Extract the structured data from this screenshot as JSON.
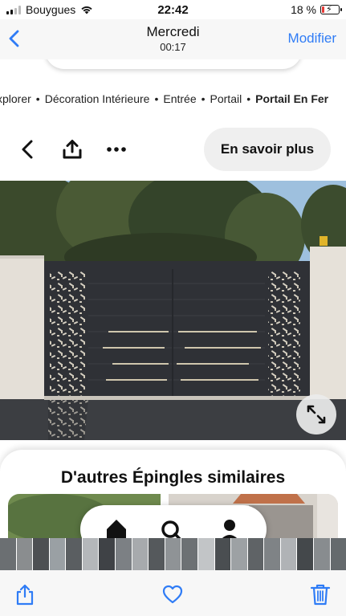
{
  "status_bar": {
    "carrier": "Bouygues",
    "time": "22:42",
    "battery_percent": "18 %",
    "battery_level": 0.18
  },
  "header": {
    "back_icon": "chevron-left-icon",
    "title": "Mercredi",
    "subtitle": "00:17",
    "edit_label": "Modifier"
  },
  "screenshot": {
    "breadcrumb": [
      "xplorer",
      "Décoration Intérieure",
      "Entrée",
      "Portail",
      "Portail En Fer"
    ],
    "breadcrumb_separator": "•",
    "toolbar": {
      "icons": [
        "chevron-left-icon",
        "share-icon",
        "more-icon"
      ],
      "learn_more_label": "En savoir plus"
    },
    "similar_title": "D'autres Épingles similaires",
    "bottom_nav_icons": [
      "home-icon",
      "search-icon",
      "profile-icon"
    ]
  },
  "bottom_toolbar": {
    "icons": [
      "share-icon",
      "heart-icon",
      "trash-icon"
    ]
  },
  "colors": {
    "accent": "#2f7cf6",
    "battery_low": "#e53935",
    "gate": "#2f3136"
  }
}
